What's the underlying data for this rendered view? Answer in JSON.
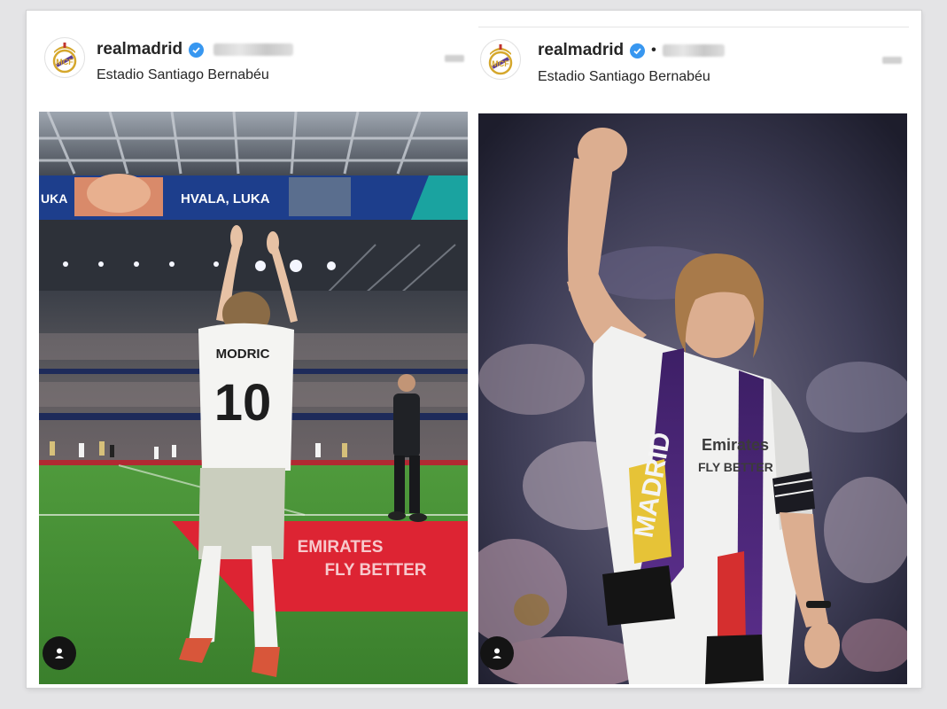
{
  "posts": [
    {
      "username": "realmadrid",
      "location": "Estadio Santiago Bernabéu",
      "photo": {
        "screen_left": "UKA",
        "screen_right": "HVALA, LUKA",
        "shirt_name": "MODRIC",
        "shirt_number": "10",
        "board_text_1": "EMIRATES",
        "board_text_2": "FLY BETTER"
      }
    },
    {
      "username": "realmadrid",
      "location": "Estadio Santiago Bernabéu",
      "photo": {
        "scarf_text": "MADRID",
        "shirt_text_1": "Emirates",
        "shirt_text_2": "FLY BETTER"
      }
    }
  ],
  "icons": {
    "verified": "verified-badge-icon",
    "crest": "real-madrid-crest-icon",
    "user_tag": "user-tag-icon"
  },
  "colors": {
    "verified_blue": "#3897f0",
    "pitch_green": "#3f8a33",
    "scarf_purple": "#5a2e8a",
    "board_red": "#dd2433",
    "crest_gold": "#d5a72c"
  }
}
